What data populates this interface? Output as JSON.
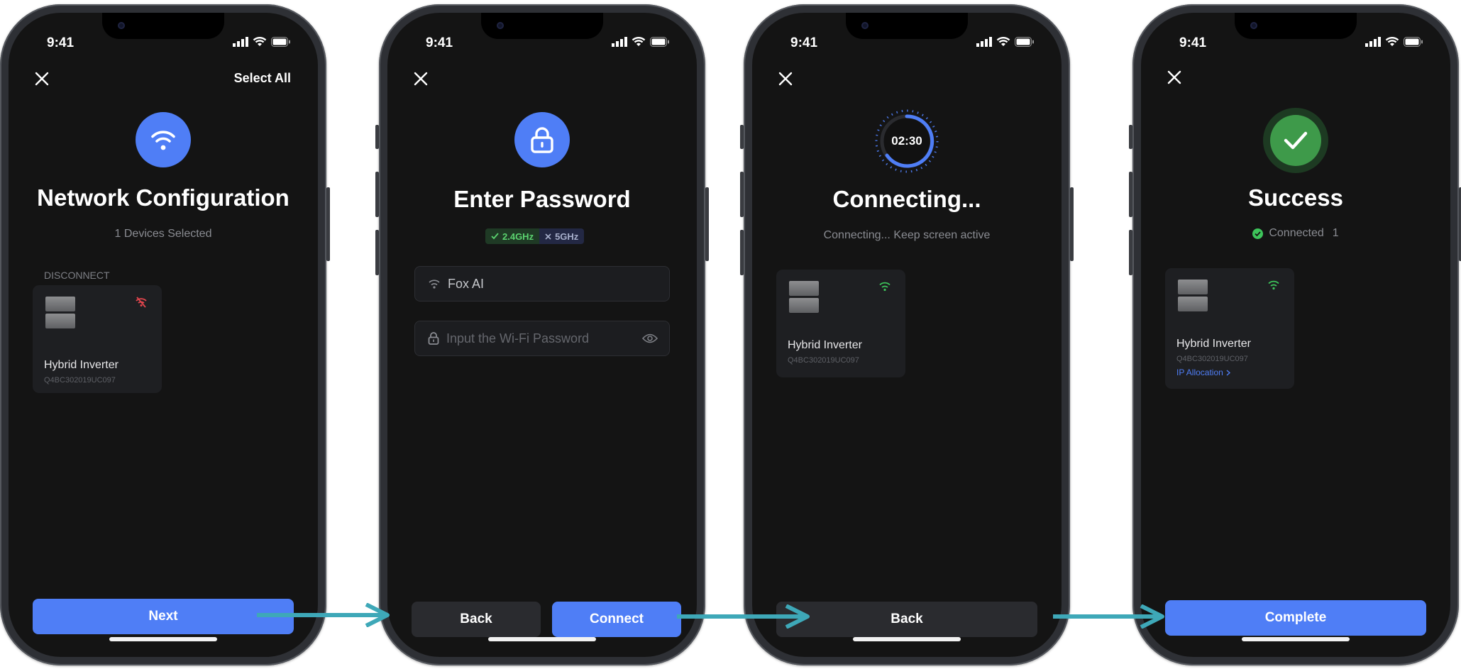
{
  "status_time": "9:41",
  "colors": {
    "accent": "#4f7ef6",
    "success": "#3e9a4a",
    "signal_ok": "#3dc45a",
    "signal_off": "#e5464e",
    "arrow": "#3ea8b8"
  },
  "screen1": {
    "header_action": "Select All",
    "title": "Network Configuration",
    "subtitle": "1 Devices Selected",
    "section_label": "DISCONNECT",
    "device": {
      "name": "Hybrid Inverter",
      "serial": "Q4BC302019UC097",
      "signal_icon": "wifi-off-icon"
    },
    "next_label": "Next"
  },
  "screen2": {
    "title": "Enter Password",
    "bands": [
      {
        "label": "2.4GHz",
        "supported": true
      },
      {
        "label": "5GHz",
        "supported": false
      }
    ],
    "ssid_value": "Fox AI",
    "password_placeholder": "Input the Wi-Fi Password",
    "back_label": "Back",
    "connect_label": "Connect"
  },
  "screen3": {
    "countdown": "02:30",
    "title": "Connecting...",
    "subtitle": "Connecting... Keep screen active",
    "device": {
      "name": "Hybrid Inverter",
      "serial": "Q4BC302019UC097",
      "signal_icon": "wifi-icon"
    },
    "back_label": "Back"
  },
  "screen4": {
    "title": "Success",
    "status_label": "Connected",
    "status_count": "1",
    "device": {
      "name": "Hybrid Inverter",
      "serial": "Q4BC302019UC097",
      "link": "IP Allocation",
      "signal_icon": "wifi-icon"
    },
    "complete_label": "Complete"
  }
}
